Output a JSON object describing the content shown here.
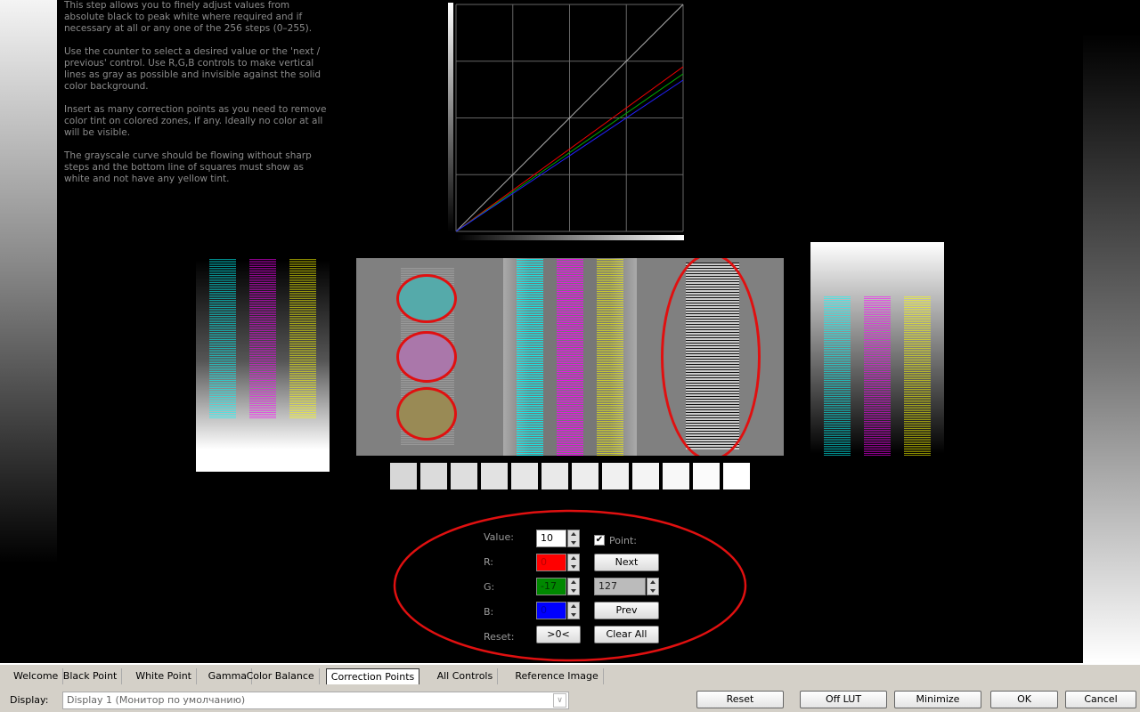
{
  "intro": [
    "This step allows you to finely adjust values from absolute black to peak white where required and if necessary at all or any one of the 256 steps (0–255).",
    "Use the counter to select a desired value or the 'next / previous' control. Use R,G,B controls to make vertical lines as gray as possible and invisible against the solid color background.",
    "Insert as many correction points as you need to remove color tint on colored zones, if any. Ideally no color at all will be visible.",
    "The grayscale curve should be flowing without sharp steps and the bottom line of squares must show as white and not have any yellow tint."
  ],
  "colors": {
    "red": "#ff0000",
    "green": "#008000",
    "blue": "#0000ff",
    "highlight": "#e01010"
  },
  "controls": {
    "value_label": "Value:",
    "value": "10",
    "point_label": "Point:",
    "point_checked": true,
    "r_label": "R:",
    "r": "0",
    "g_label": "G:",
    "g": "-17",
    "b_label": "B:",
    "b": "0",
    "reset_label": "Reset:",
    "reset_btn": ">0<",
    "next": "Next",
    "prev": "Prev",
    "clear": "Clear All",
    "point_value": "127"
  },
  "tabs": [
    "Welcome",
    "Black Point",
    "White Point",
    "Gamma",
    "Color Balance",
    "Correction Points",
    "All Controls",
    "Reference Image"
  ],
  "active_tab": "Correction Points",
  "display": {
    "label": "Display:",
    "value": "Display 1 (Монитор по умолчанию)"
  },
  "buttons": {
    "reset": "Reset",
    "off_lut": "Off LUT",
    "minimize": "Minimize",
    "ok": "OK",
    "cancel": "Cancel"
  }
}
